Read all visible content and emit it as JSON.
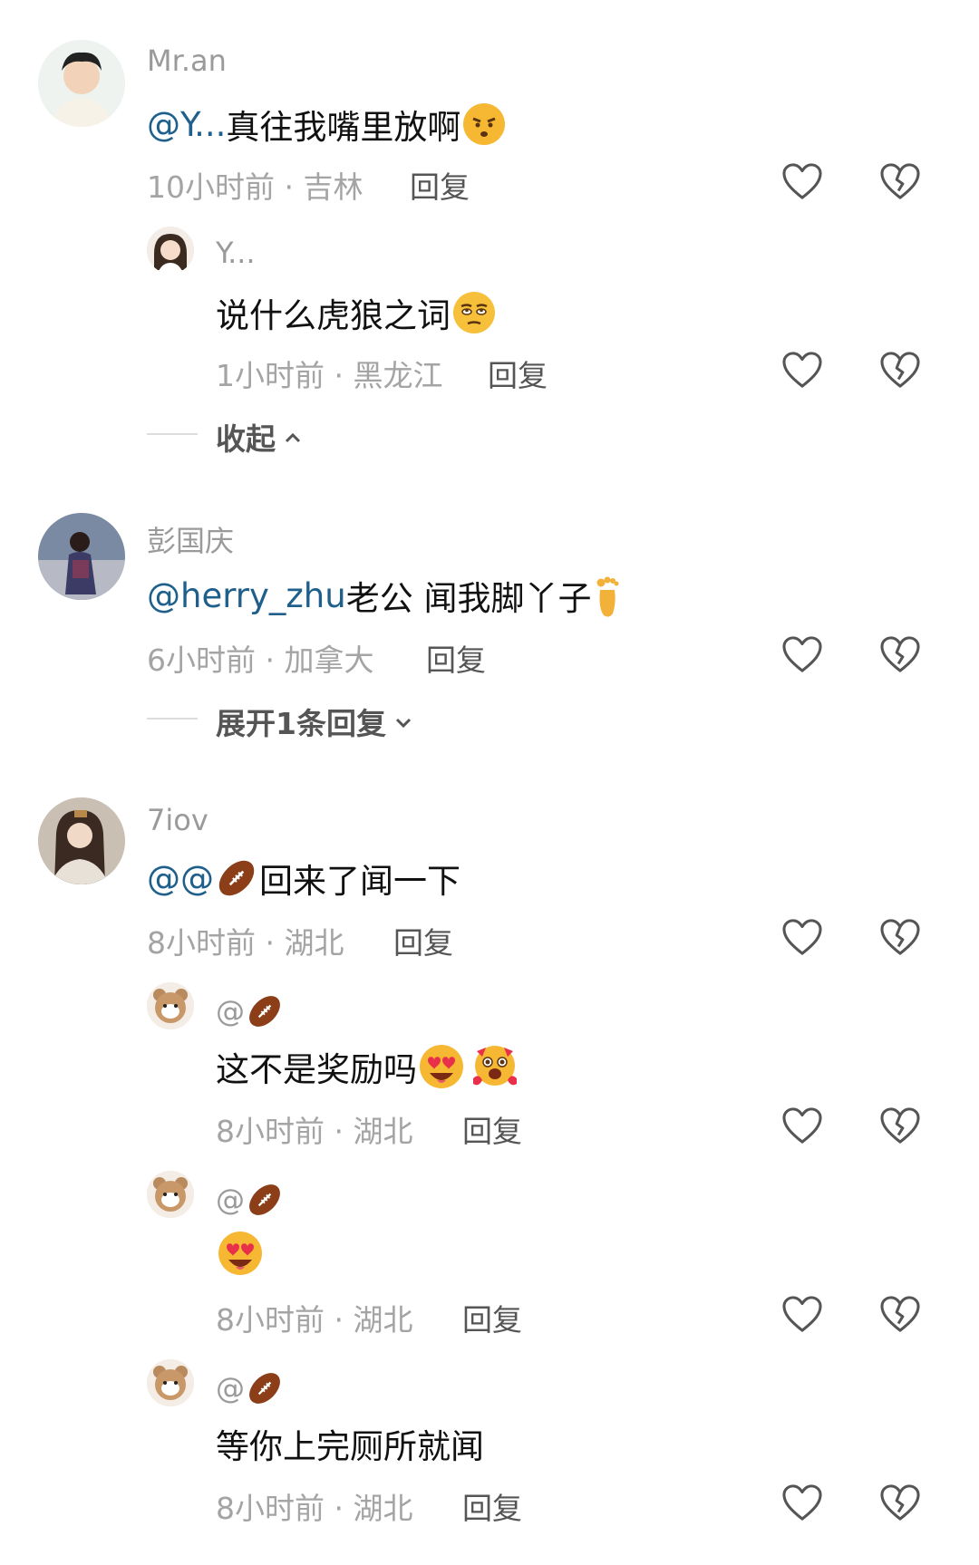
{
  "comments": [
    {
      "username": "Mr.an",
      "mention": "@Y...",
      "text": " 真往我嘴里放啊",
      "emoji": "angry-face-emoji",
      "time_location": "10小时前 · 吉林",
      "reply_label": "回复",
      "replies": [
        {
          "username": "Y...",
          "text": "说什么虎狼之词",
          "emoji": "rolling-eyes-emoji",
          "time_location": "1小时前 · 黑龙江",
          "reply_label": "回复"
        }
      ],
      "toggle_label": "收起"
    },
    {
      "username": "彭国庆",
      "mention": "@herry_zhu",
      "text": " 老公 闻我脚丫子",
      "emoji": "foot-emoji",
      "time_location": "6小时前 · 加拿大",
      "reply_label": "回复",
      "toggle_label": "展开1条回复"
    },
    {
      "username": "7iov",
      "mention": "@@",
      "text": " 回来了闻一下",
      "emoji": "football-emoji",
      "time_location": "8小时前 · 湖北",
      "reply_label": "回复",
      "replies": [
        {
          "username": "@",
          "text": "这不是奖励吗",
          "emoji": "heart-eyes-emoji",
          "time_location": "8小时前 · 湖北",
          "reply_label": "回复"
        },
        {
          "username": "@",
          "text": "",
          "emoji": "heart-eyes-emoji",
          "time_location": "8小时前 · 湖北",
          "reply_label": "回复"
        },
        {
          "username": "@",
          "text": "等你上完厕所就闻",
          "emoji": "",
          "time_location": "8小时前 · 湖北",
          "reply_label": "回复"
        }
      ]
    }
  ],
  "colors": {
    "mention": "#1f5f8b",
    "meta": "#a4a4a4",
    "username": "#9a9a9a"
  }
}
